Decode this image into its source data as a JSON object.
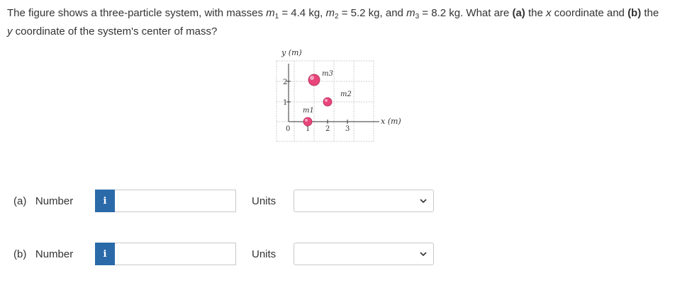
{
  "question": {
    "text_1": "The figure shows a three-particle system, with masses ",
    "m1_sym": "m",
    "m1_sub": "1",
    "m1_val": " = 4.4 kg, ",
    "m2_sym": "m",
    "m2_sub": "2",
    "m2_val": " = 5.2 kg, and ",
    "m3_sym": "m",
    "m3_sub": "3",
    "m3_val": " = 8.2 kg. What are ",
    "part_a": "(a)",
    "text_2": " the ",
    "x_sym": "x",
    "text_3": " coordinate and ",
    "part_b": "(b)",
    "text_4": " the ",
    "y_sym": "y",
    "text_5": " coordinate of the system's center of mass?"
  },
  "figure": {
    "y_axis_label": "y (m)",
    "x_axis_label": "x (m)",
    "x_ticks": [
      "0",
      "1",
      "2",
      "3"
    ],
    "y_ticks": [
      "1",
      "2"
    ],
    "particles": [
      {
        "label": "m1",
        "x": 1,
        "y": 0
      },
      {
        "label": "m2",
        "x": 2,
        "y": 1
      },
      {
        "label": "m3",
        "x": 1,
        "y": 2
      }
    ],
    "particle_color": "#e8457a"
  },
  "answers": [
    {
      "part": "(a)",
      "label": "Number",
      "info_icon": "i",
      "value": "",
      "units_label": "Units",
      "units_value": ""
    },
    {
      "part": "(b)",
      "label": "Number",
      "info_icon": "i",
      "value": "",
      "units_label": "Units",
      "units_value": ""
    }
  ],
  "colors": {
    "info_button": "#2a6aa9",
    "border": "#c8c8c8"
  }
}
